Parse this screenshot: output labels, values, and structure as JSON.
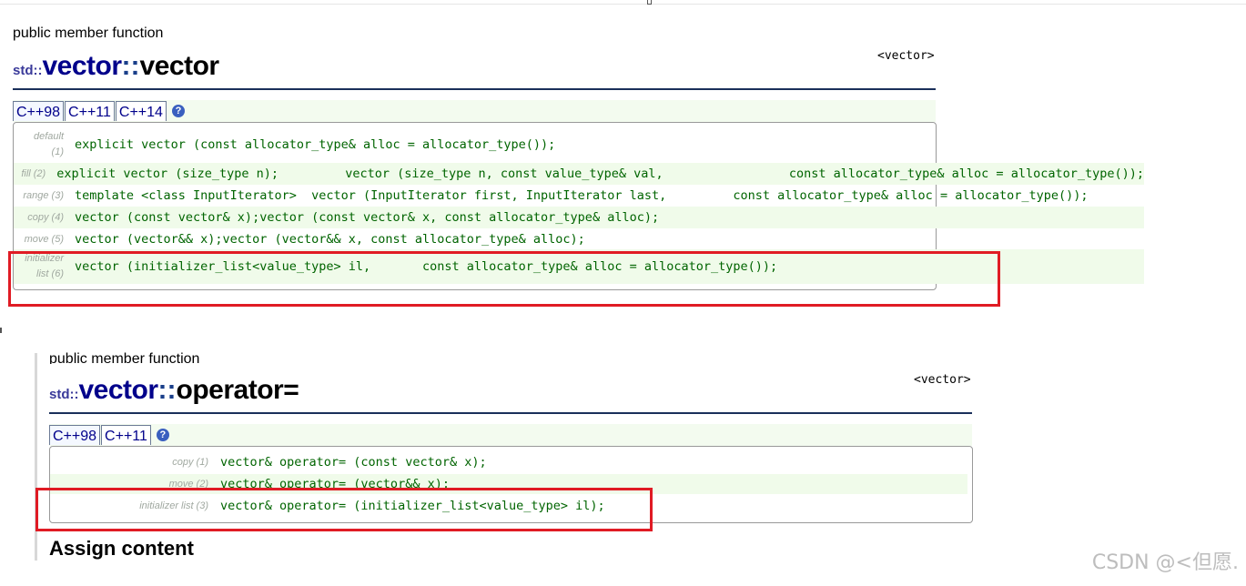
{
  "section1": {
    "type_label": "public member function",
    "title_ns": "std::",
    "title_class": "vector",
    "title_sep": "::",
    "title_func": "vector",
    "header_tag": "<vector>",
    "tabs": [
      "C++98",
      "C++11",
      "C++14"
    ],
    "help": "?",
    "rows": [
      {
        "label_line1": "default",
        "label_line2": "(1)",
        "code": "explicit vector (const allocator_type& alloc = allocator_type());"
      },
      {
        "label_line1": "fill (2)",
        "label_line2": "",
        "code": "explicit vector (size_type n);         vector (size_type n, const value_type& val,                 const allocator_type& alloc = allocator_type());"
      },
      {
        "label_line1": "range (3)",
        "label_line2": "",
        "code": "template <class InputIterator>  vector (InputIterator first, InputIterator last,         const allocator_type& alloc = allocator_type());"
      },
      {
        "label_line1": "copy (4)",
        "label_line2": "",
        "code": "vector (const vector& x);vector (const vector& x, const allocator_type& alloc);"
      },
      {
        "label_line1": "move (5)",
        "label_line2": "",
        "code": "vector (vector&& x);vector (vector&& x, const allocator_type& alloc);"
      },
      {
        "label_line1": "initializer",
        "label_line2": "list (6)",
        "code": "vector (initializer_list<value_type> il,       const allocator_type& alloc = allocator_type());"
      }
    ]
  },
  "section2": {
    "type_label": "public member function",
    "title_ns": "std::",
    "title_class": "vector",
    "title_sep": "::",
    "title_func": "operator=",
    "header_tag": "<vector>",
    "tabs": [
      "C++98",
      "C++11"
    ],
    "help": "?",
    "rows": [
      {
        "label": "copy (1)",
        "code": "vector& operator= (const vector& x);"
      },
      {
        "label": "move (2)",
        "code": "vector& operator= (vector&& x);"
      },
      {
        "label": "initializer list (3)",
        "code": "vector& operator= (initializer_list<value_type> il);"
      }
    ],
    "heading": "Assign content"
  },
  "watermark": "CSDN @<但愿."
}
